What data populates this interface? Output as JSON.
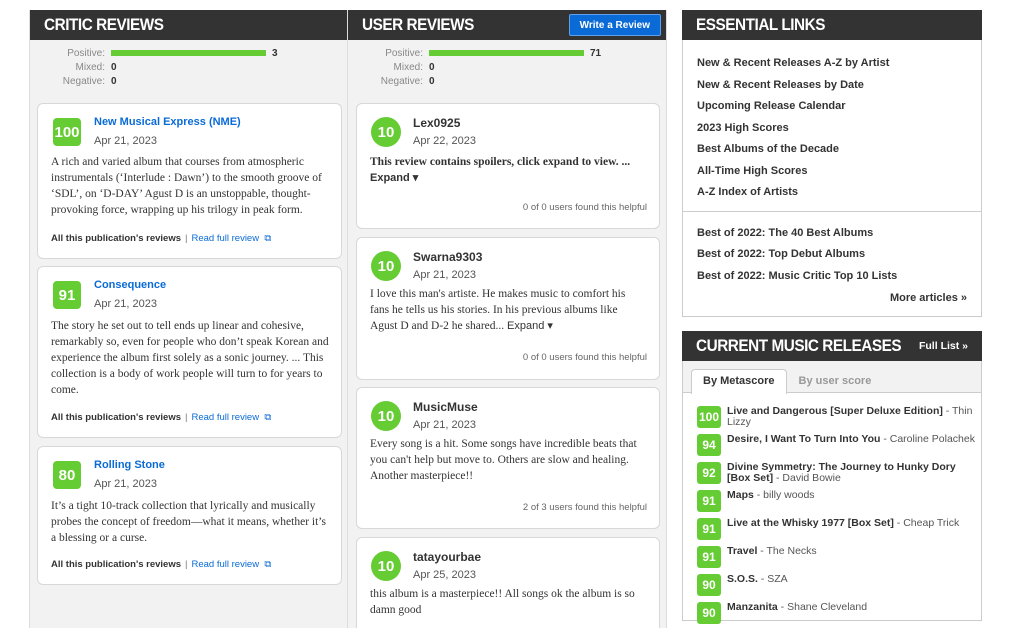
{
  "critic": {
    "title": "CRITIC REVIEWS",
    "dist": {
      "positive_label": "Positive:",
      "positive": "3",
      "mixed_label": "Mixed:",
      "mixed": "0",
      "negative_label": "Negative:",
      "negative": "0"
    },
    "reviews": [
      {
        "score": "100",
        "source": "New Musical Express (NME)",
        "date": "Apr 21, 2023",
        "text": "A rich and varied album that courses from atmospheric instrumentals (‘Interlude : Dawn’) to the smooth groove of ‘SDL’, on ‘D-DAY’ Agust D is an unstoppable, thought-provoking force, wrapping up his trilogy in peak form.",
        "all_label": "All this publication's reviews",
        "read_label": "Read full review"
      },
      {
        "score": "91",
        "source": "Consequence",
        "date": "Apr 21, 2023",
        "text": "The story he set out to tell ends up linear and cohesive, remarkably so, even for people who don’t speak Korean and experience the album first solely as a sonic journey. ... This collection is a body of work people will turn to for years to come.",
        "all_label": "All this publication's reviews",
        "read_label": "Read full review"
      },
      {
        "score": "80",
        "source": "Rolling Stone",
        "date": "Apr 21, 2023",
        "text": "It’s a tight 10-track collection that lyrically and musically probes the concept of freedom—what it means, whether it’s a blessing or a curse.",
        "all_label": "All this publication's reviews",
        "read_label": "Read full review"
      }
    ]
  },
  "user": {
    "title": "USER REVIEWS",
    "write_label": "Write a Review",
    "dist": {
      "positive_label": "Positive:",
      "positive": "71",
      "mixed_label": "Mixed:",
      "mixed": "0",
      "negative_label": "Negative:",
      "negative": "0"
    },
    "reviews": [
      {
        "score": "10",
        "user": "Lex0925",
        "date": "Apr 22, 2023",
        "text": "This review contains spoilers, click expand to view. ...",
        "expand": "Expand ▾",
        "helpful": "0 of 0 users found this helpful"
      },
      {
        "score": "10",
        "user": "Swarna9303",
        "date": "Apr 21, 2023",
        "text": "I love this man's artiste. He makes music to comfort his fans he tells us his stories. In his previous albums like Agust D and D-2 he shared...",
        "expand": "Expand ▾",
        "helpful": "0 of 0 users found this helpful"
      },
      {
        "score": "10",
        "user": "MusicMuse",
        "date": "Apr 21, 2023",
        "text": "Every song is a hit. Some songs have incredible beats that you can't help but move to. Others are slow and healing. Another masterpiece!!",
        "helpful": "2 of 3 users found this helpful"
      },
      {
        "score": "10",
        "user": "tatayourbae",
        "date": "Apr 25, 2023",
        "text": "this album is a masterpiece!! All songs ok the album is so damn good"
      }
    ]
  },
  "essential": {
    "title": "ESSENTIAL LINKS",
    "links": [
      "New & Recent Releases A-Z by Artist",
      "New & Recent Releases by Date",
      "Upcoming Release Calendar",
      "2023 High Scores",
      "Best Albums of the Decade",
      "All-Time High Scores",
      "A-Z Index of Artists"
    ],
    "articles": [
      "Best of 2022: The 40 Best Albums",
      "Best of 2022: Top Debut Albums",
      "Best of 2022: Music Critic Top 10 Lists"
    ],
    "more": "More articles »"
  },
  "current": {
    "title": "CURRENT MUSIC RELEASES",
    "full_list": "Full List »",
    "tabs": [
      "By Metascore",
      "By user score"
    ],
    "releases": [
      {
        "score": "100",
        "title": "Live and Dangerous [Super Deluxe Edition]",
        "artist": " - Thin Lizzy"
      },
      {
        "score": "94",
        "title": "Desire, I Want To Turn Into You",
        "artist": " - Caroline Polachek"
      },
      {
        "score": "92",
        "title": "Divine Symmetry: The Journey to Hunky Dory [Box Set]",
        "artist": " - David Bowie"
      },
      {
        "score": "91",
        "title": "Maps",
        "artist": " - billy woods"
      },
      {
        "score": "91",
        "title": "Live at the Whisky 1977 [Box Set]",
        "artist": " - Cheap Trick"
      },
      {
        "score": "91",
        "title": "Travel",
        "artist": " - The Necks"
      },
      {
        "score": "90",
        "title": "S.O.S.",
        "artist": " - SZA"
      },
      {
        "score": "90",
        "title": "Manzanita",
        "artist": " - Shane Cleveland"
      }
    ]
  },
  "colors": {
    "score_green": "#66cc33",
    "link_blue": "#0a6bd6",
    "header_dark": "#333333"
  }
}
